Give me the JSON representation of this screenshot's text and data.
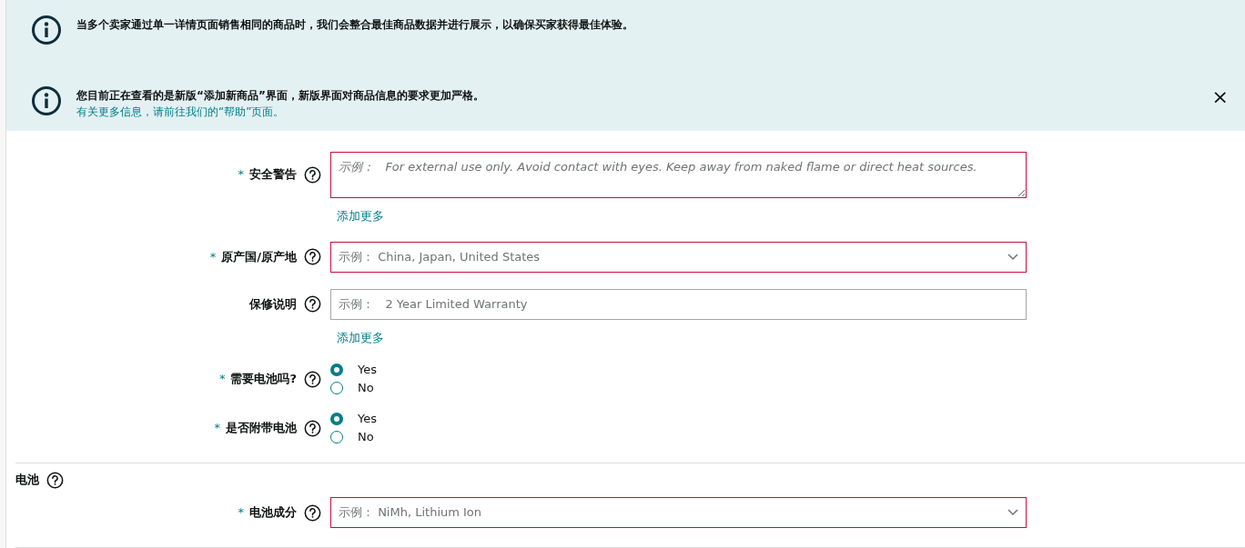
{
  "alerts": [
    {
      "text": "当多个卖家通过单一详情页面销售相同的商品时，我们会整合最佳商品数据并进行展示，以确保买家获得最佳体验。"
    },
    {
      "text": "您目前正在查看的是新版“添加新商品”界面，新版界面对商品信息的要求更加严格。",
      "link": "有关更多信息，请前往我们的“帮助”页面。",
      "close": "×"
    }
  ],
  "fields": [
    {
      "kind": "textarea",
      "label": "安全警告",
      "required_mark": "*",
      "placeholder": "示例：   For external use only. Avoid contact with eyes. Keep away from naked flame or direct heat sources.",
      "error": true,
      "add_more": "添加更多"
    },
    {
      "kind": "select",
      "label": "原产国/原产地",
      "required_mark": "*",
      "placeholder": "示例：   China, Japan, United States",
      "error": true
    },
    {
      "kind": "input",
      "label": "保修说明",
      "placeholder": "示例：   2 Year Limited Warranty",
      "error": false,
      "add_more": "添加更多"
    },
    {
      "kind": "radio",
      "label": "需要电池吗?",
      "required_mark": "*",
      "options": [
        {
          "label": "Yes",
          "selected": true
        },
        {
          "label": "No",
          "selected": false
        }
      ]
    },
    {
      "kind": "radio",
      "label": "是否附带电池",
      "required_mark": "*",
      "options": [
        {
          "label": "Yes",
          "selected": true
        },
        {
          "label": "No",
          "selected": false
        }
      ]
    }
  ],
  "battery_section": {
    "title": "电池",
    "fields": [
      {
        "kind": "select",
        "label": "电池成分",
        "required_mark": "*",
        "placeholder": "示例：   NiMh, Lithium Ion",
        "error": true
      }
    ]
  }
}
